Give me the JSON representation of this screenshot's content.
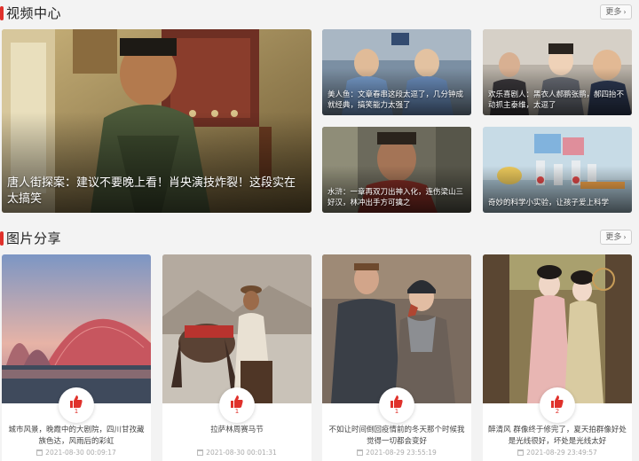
{
  "video_section": {
    "title": "视频中心",
    "more_label": "更多",
    "items": [
      {
        "caption": "唐人街探案：建议不要晚上看！肖央演技炸裂！这段实在太搞笑"
      },
      {
        "caption": "美人鱼：文章春串这段太逗了，几分钟成就经典，搞笑能力太强了"
      },
      {
        "caption": "欢乐喜剧人：黑衣人郝鹏张鹏，郝四抬不动抓主泰维，太逗了"
      },
      {
        "caption": "水浒：一章再双刀出神入化，连伤梁山三好汉，林冲出手方可擒之"
      },
      {
        "caption": "奇妙的科学小实验，让孩子爱上科学"
      }
    ]
  },
  "picture_section": {
    "title": "图片分享",
    "more_label": "更多",
    "items": [
      {
        "desc": "城市风景，晚霞中的大剧院，四川甘孜藏族色达，风雨后的彩虹",
        "likes": "1",
        "time": "2021-08-30 00:09:17"
      },
      {
        "desc": "拉萨林周赛马节",
        "likes": "1",
        "time": "2021-08-30 00:01:31"
      },
      {
        "desc": "不如让时间倒回疫情前的冬天那个时候我觉得一切都会变好",
        "likes": "1",
        "time": "2021-08-29 23:55:19"
      },
      {
        "desc": "醉清风 群像终于修完了，夏天拍群像好处是光线很好，坏处是光线太好",
        "likes": "2",
        "time": "2021-08-29 23:49:57"
      }
    ]
  },
  "colors": {
    "accent": "#e0312b",
    "background": "#f3f3f3"
  },
  "icons": {
    "like": "thumbs-up-icon",
    "time": "calendar-icon",
    "more": "chevron-right-icon"
  }
}
